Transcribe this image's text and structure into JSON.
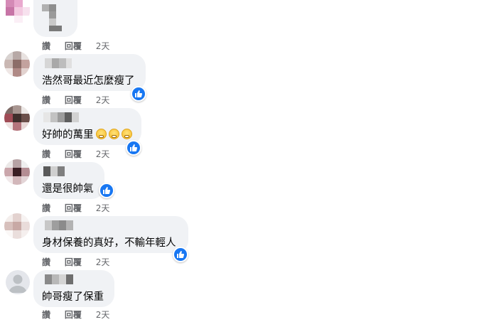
{
  "comments": [
    {
      "text": "",
      "actions": {
        "like": "讚",
        "reply": "回覆",
        "time": "2天"
      }
    },
    {
      "text": "浩然哥最近怎麼瘦了",
      "actions": {
        "like": "讚",
        "reply": "回覆",
        "time": "2天"
      }
    },
    {
      "text": "好帥的萬里",
      "actions": {
        "like": "讚",
        "reply": "回覆",
        "time": "2天"
      }
    },
    {
      "text": "還是很帥氣",
      "actions": {
        "like": "讚",
        "reply": "回覆",
        "time": "2天"
      }
    },
    {
      "text": "身材保養的真好，不輸年輕人",
      "actions": {
        "like": "讚",
        "reply": "回覆",
        "time": "2天"
      }
    },
    {
      "text": "帥哥瘦了保重",
      "actions": {
        "like": "讚",
        "reply": "回覆",
        "time": "2天"
      }
    }
  ],
  "icons": {
    "like_reaction": "like-reaction-icon",
    "emoji": "grinning-face-emoji",
    "default_avatar": "default-avatar-icon"
  },
  "colors": {
    "bubble": "#f0f2f5",
    "like_blue": "#1877f2",
    "meta_text": "#65676b"
  }
}
